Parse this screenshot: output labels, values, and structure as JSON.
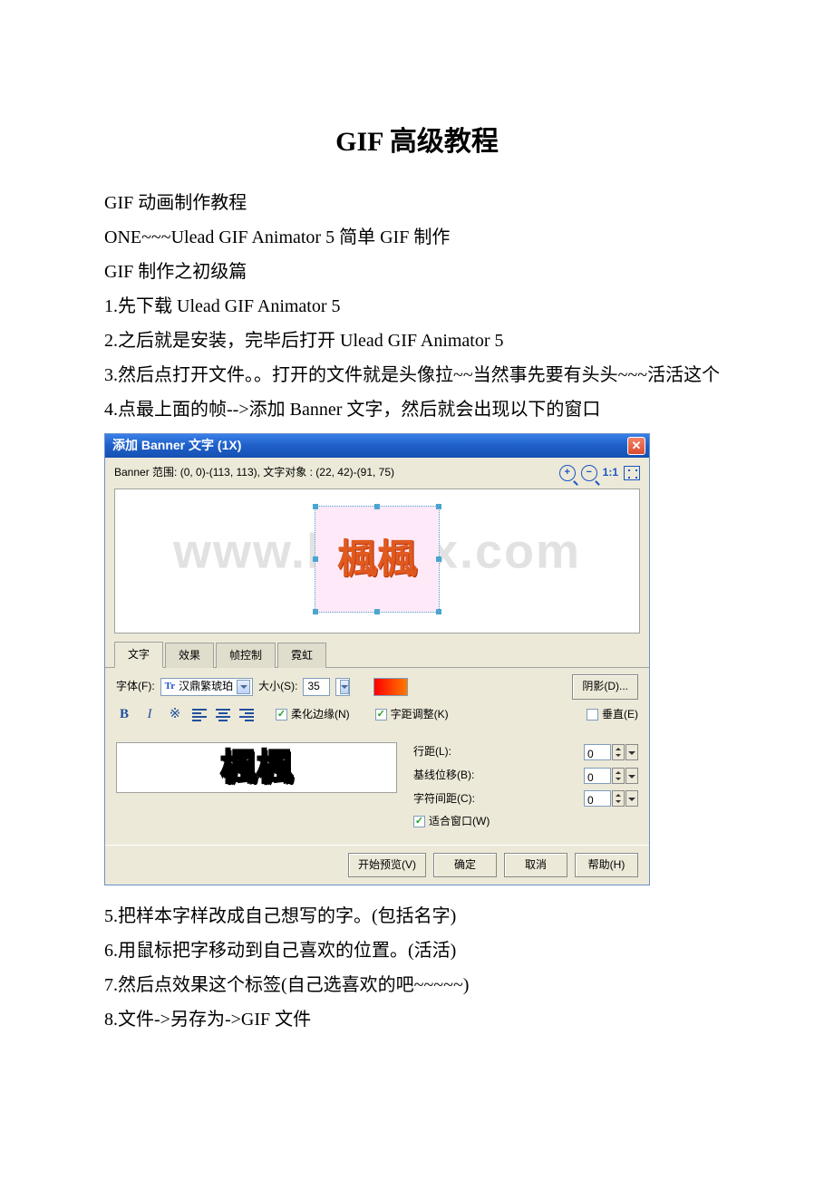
{
  "doc": {
    "title": "GIF 高级教程",
    "lines": [
      "GIF 动画制作教程",
      "ONE~~~Ulead GIF Animator 5 简单 GIF 制作",
      "GIF 制作之初级篇",
      "1.先下载 Ulead GIF Animator 5",
      "2.之后就是安装，完毕后打开 Ulead GIF Animator 5",
      "3.然后点打开文件。。打开的文件就是头像拉~~当然事先要有头头~~~活活这个",
      "4.点最上面的帧-->添加 Banner 文字，然后就会出现以下的窗口"
    ],
    "post_lines": [
      "5.把样本字样改成自己想写的字。(包括名字)",
      "6.用鼠标把字移动到自己喜欢的位置。(活活)",
      "7.然后点效果这个标签(自己选喜欢的吧~~~~~)",
      "8.文件->另存为->GIF 文件"
    ]
  },
  "dialog": {
    "title": "添加 Banner 文字 (1X)",
    "info": "Banner 范围: (0, 0)-(113, 113), 文字对象 : (22, 42)-(91, 75)",
    "ratio": "1:1",
    "watermark": "www.bdocx.com",
    "sample_text": "楓楓",
    "tabs": [
      "文字",
      "效果",
      "帧控制",
      "霓虹"
    ],
    "labels": {
      "font": "字体(F):",
      "size": "大小(S):",
      "shadow": "阴影(D)...",
      "soften": "柔化边缘(N)",
      "kerning": "字距调整(K)",
      "vertical": "垂直(E)",
      "line_spacing": "行距(L):",
      "baseline": "基线位移(B):",
      "char_spacing": "字符间距(C):",
      "fit_window": "适合窗口(W)",
      "start_preview": "开始预览(V)",
      "ok": "确定",
      "cancel": "取消",
      "help": "帮助(H)"
    },
    "values": {
      "font_name": "汉鼎繁琥珀",
      "size": "35",
      "line_spacing": "0",
      "baseline": "0",
      "char_spacing": "0"
    },
    "checks": {
      "soften": true,
      "kerning": true,
      "vertical": false,
      "fit_window": true
    }
  }
}
